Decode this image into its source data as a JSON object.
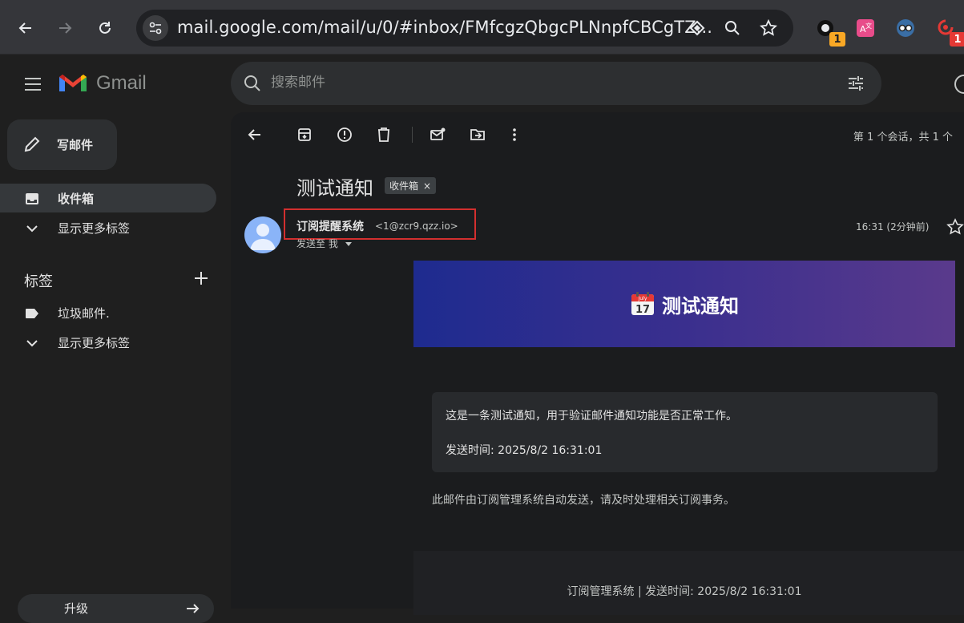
{
  "browser": {
    "url": "mail.google.com/mail/u/0/#inbox/FMfcgzQbgcPLNnpfCBCgTZ...",
    "extensions": [
      {
        "icon": "extension-dark-icon",
        "badge": "1"
      },
      {
        "icon": "translate-extension-icon",
        "badge": ""
      },
      {
        "icon": "glasses-extension-icon",
        "badge": ""
      },
      {
        "icon": "red-extension-icon",
        "badge": "1"
      }
    ]
  },
  "gmail": {
    "brand": "Gmail",
    "search_placeholder": "搜索邮件"
  },
  "sidebar": {
    "compose": "写邮件",
    "inbox": "收件箱",
    "show_more_1": "显示更多标签",
    "labels_heading": "标签",
    "label_item": "垃圾邮件.",
    "show_more_2": "显示更多标签",
    "upgrade": "升级"
  },
  "toolbar": {
    "conversation_count": "第 1 个会话，共 1 个"
  },
  "message": {
    "subject": "测试通知",
    "chip": "收件箱",
    "chip_close": "×",
    "sender_name": "订阅提醒系统",
    "sender_email": "<1@zcr9.qzz.io>",
    "to": "发送至 我",
    "time": "16:31 (2分钟前)",
    "banner_title": "测试通知",
    "banner_icon_month": "July",
    "banner_icon_day": "17",
    "body_line1": "这是一条测试通知，用于验证邮件通知功能是否正常工作。",
    "body_line2": "发送时间: 2025/8/2 16:31:01",
    "auto_note": "此邮件由订阅管理系统自动发送，请及时处理相关订阅事务。",
    "footer": "订阅管理系统 | 发送时间: 2025/8/2 16:31:01"
  },
  "colors": {
    "highlight_box": "#d32f2f",
    "banner_start": "#1e2b8f",
    "banner_end": "#5a3a8c"
  }
}
